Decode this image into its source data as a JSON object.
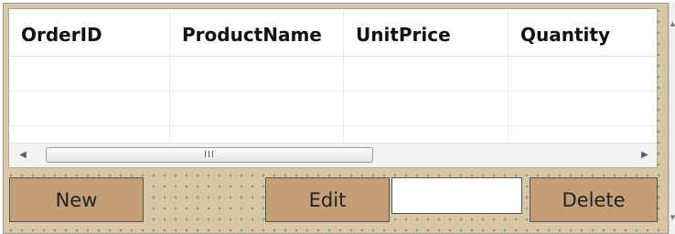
{
  "grid": {
    "columns": [
      "OrderID",
      "ProductName",
      "UnitPrice",
      "Quantity"
    ],
    "rows": [
      [
        "",
        "",
        "",
        ""
      ],
      [
        "",
        "",
        "",
        ""
      ],
      [
        "",
        "",
        "",
        ""
      ]
    ],
    "scroll_left_icon": "arrow-left",
    "scroll_right_icon": "arrow-right",
    "thumb_grip": "III"
  },
  "toolbar": {
    "new_label": "New",
    "edit_label": "Edit",
    "delete_label": "Delete",
    "edit_input_value": ""
  },
  "colors": {
    "panel_background": "#d9c6a4",
    "button_background": "#c39e76",
    "dot_color": "#55a86a"
  }
}
